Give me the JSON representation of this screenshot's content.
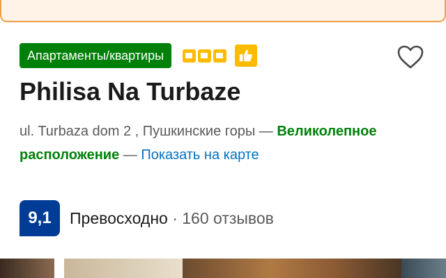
{
  "property": {
    "type_badge": "Апартаменты/квартиры",
    "quality_squares": 3,
    "preferred_badge_icon": "thumbs-up-icon",
    "title": "Philisa Na Turbaze",
    "address": "ul. Turbaza dom 2 , Пушкинские горы",
    "address_separator": "—",
    "location_highlight": "Великолепное расположение",
    "location_separator": "—",
    "map_link": "Показать на карте",
    "favorite_icon": "heart-icon"
  },
  "rating": {
    "score": "9,1",
    "word": "Превосходно",
    "dot": "·",
    "reviews": "160 отзывов"
  },
  "colors": {
    "badge_green": "#008009",
    "genius_yellow": "#febb02",
    "score_blue": "#003b95",
    "link_blue": "#0071c2",
    "banner_border": "#f0a04b"
  }
}
